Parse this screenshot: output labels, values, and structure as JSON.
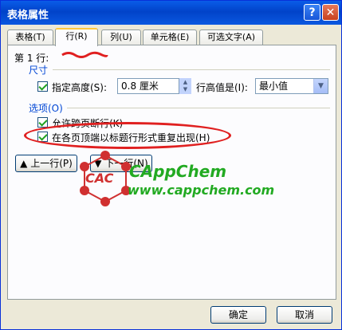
{
  "dialog": {
    "title": "表格属性",
    "help_label": "?",
    "close_label": "✕"
  },
  "tabs": [
    {
      "label": "表格(T)"
    },
    {
      "label": "行(R)"
    },
    {
      "label": "列(U)"
    },
    {
      "label": "单元格(E)"
    },
    {
      "label": "可选文字(A)"
    }
  ],
  "row_panel": {
    "row_heading": "第 1 行:",
    "size_section": "尺寸",
    "specify_height_label": "指定高度(S):",
    "specify_height_checked": true,
    "height_value": "0.8 厘米",
    "row_height_is_label": "行高值是(I):",
    "row_height_mode": "最小值",
    "options_section": "选项(O)",
    "allow_break_label": "允许跨页断行(K)",
    "allow_break_checked": true,
    "repeat_header_label": "在各页顶端以标题行形式重复出现(H)",
    "repeat_header_checked": true,
    "prev_row_label": "上一行(P)",
    "next_row_label": "下一行(N)"
  },
  "footer": {
    "ok_label": "确定",
    "cancel_label": "取消"
  },
  "watermark": {
    "logo_text": "CAC",
    "brand": "CAppChem",
    "url": "www.cappchem.com"
  },
  "colors": {
    "titlebar": "#0a5ce8",
    "dialog_bg": "#ece9d8",
    "panel_bg": "#fcfcfe",
    "section_label": "#0046d5",
    "annotation_red": "#e02020",
    "watermark_green": "#22aa22",
    "watermark_red": "#d03030"
  }
}
